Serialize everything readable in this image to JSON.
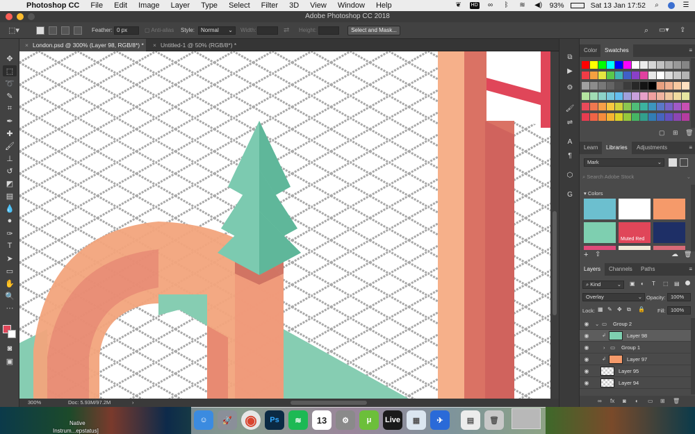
{
  "menubar": {
    "app_name": "Photoshop CC",
    "items": [
      "File",
      "Edit",
      "Image",
      "Layer",
      "Type",
      "Select",
      "Filter",
      "3D",
      "View",
      "Window",
      "Help"
    ],
    "status_icons": [
      "evernote-icon",
      "hd-icon",
      "creative-cloud-icon",
      "bluetooth-icon",
      "wifi-icon",
      "volume-icon"
    ],
    "battery": "93%",
    "datetime": "Sat 13 Jan  17:52"
  },
  "window": {
    "title": "Adobe Photoshop CC 2018"
  },
  "options": {
    "feather_label": "Feather:",
    "feather_value": "0 px",
    "antialias_label": "Anti-alias",
    "style_label": "Style:",
    "style_value": "Normal",
    "width_label": "Width:",
    "height_label": "Height:",
    "select_mask_label": "Select and Mask..."
  },
  "tabs": [
    {
      "label": "London.psd @ 300% (Layer 98, RGB/8*) *"
    },
    {
      "label": "Untitled-1 @ 50% (RGB/8*) *"
    }
  ],
  "status": {
    "zoom": "300%",
    "doc": "Doc: 5.93M/97.2M"
  },
  "color_panel": {
    "tabs": [
      "Color",
      "Swatches"
    ],
    "active_tab": "Swatches",
    "swatch_rows": [
      [
        "#ff0000",
        "#ffff00",
        "#00ff00",
        "#00ffff",
        "#0000ff",
        "#ff00ff",
        "#ffffff",
        "#ebebeb",
        "#d6d6d6",
        "#c2c2c2",
        "#adadad",
        "#999999",
        "#858585"
      ],
      [
        "#f03c46",
        "#f5a040",
        "#e6e640",
        "#5ac84a",
        "#40b4b4",
        "#4060c8",
        "#8a40c8",
        "#e040a0",
        "#e8e8e8",
        "#ffffff",
        "#dcdcdc",
        "#c8c8c8",
        "#b4b4b4"
      ],
      [
        "#a0a0a0",
        "#8c8c8c",
        "#787878",
        "#646464",
        "#505050",
        "#3c3c3c",
        "#282828",
        "#141414",
        "#000000",
        "#e8a080",
        "#f0b090",
        "#f8c8a0",
        "#ffe0c0"
      ],
      [
        "#b4e6a0",
        "#a0dcb4",
        "#8cd2c8",
        "#78c8dc",
        "#64beF0",
        "#a0a0dc",
        "#c8a0dc",
        "#e6a0c8",
        "#f0a0a0",
        "#f0b4a0",
        "#f0c8a0",
        "#f0dca0",
        "#e6e6a0"
      ],
      [
        "#e84a5a",
        "#f07850",
        "#f8a048",
        "#f8c840",
        "#d2d23c",
        "#8cc850",
        "#50be78",
        "#3cb4a0",
        "#3c96be",
        "#5a78c8",
        "#7864c8",
        "#a05ac8",
        "#c850b4"
      ],
      [
        "#e63c50",
        "#f06446",
        "#f58c3c",
        "#f5b432",
        "#dcd228",
        "#96c83c",
        "#46b464",
        "#32a08c",
        "#327db4",
        "#4664be",
        "#6450be",
        "#8c46b4",
        "#b43ca0"
      ]
    ]
  },
  "libraries_panel": {
    "tabs": [
      "Learn",
      "Libraries",
      "Adjustments"
    ],
    "active_tab": "Libraries",
    "library_name": "Mark",
    "search_placeholder": "Search Adobe Stock",
    "section": "Colors",
    "colors": [
      {
        "hex": "#6cbfcf"
      },
      {
        "hex": "#ffffff"
      },
      {
        "hex": "#f59a6a"
      },
      {
        "hex": "#7ecfb0"
      },
      {
        "hex": "#e04659",
        "label": "Muted Red"
      },
      {
        "hex": "#1e2f66"
      },
      {
        "hex": "#e04a7a"
      },
      {
        "hex": "#f2ead8"
      },
      {
        "hex": "#d86a78"
      }
    ]
  },
  "layers_panel": {
    "tabs": [
      "Layers",
      "Channels",
      "Paths"
    ],
    "active_tab": "Layers",
    "filter_kind": "Kind",
    "blend_mode": "Overlay",
    "opacity_label": "Opacity:",
    "opacity": "100%",
    "lock_label": "Lock:",
    "fill_label": "Fill:",
    "fill": "100%",
    "layers": [
      {
        "name": "Group 2",
        "type": "group",
        "indent": 0
      },
      {
        "name": "Layer 98",
        "type": "layer",
        "indent": 1,
        "thumb": "#7ecfb0",
        "selected": true
      },
      {
        "name": "Group 1",
        "type": "group",
        "indent": 1
      },
      {
        "name": "Layer 97",
        "type": "layer",
        "indent": 1,
        "thumb": "#f59a6a"
      },
      {
        "name": "Layer 95",
        "type": "layer",
        "indent": 0,
        "thumb": "checker"
      },
      {
        "name": "Layer 94",
        "type": "layer",
        "indent": 0,
        "thumb": "checker"
      }
    ]
  },
  "desktop": {
    "label_1": "Native",
    "label_2": "Instrum...epstatus]"
  },
  "dock": {
    "items": [
      {
        "name": "finder",
        "bg": "#3b8be0",
        "glyph": "☺"
      },
      {
        "name": "launchpad",
        "bg": "#8a8f99",
        "glyph": "🚀"
      },
      {
        "name": "chrome",
        "bg": "#e6e6e6",
        "glyph": "◉"
      },
      {
        "name": "photoshop",
        "bg": "#0b2a44",
        "glyph": "Ps"
      },
      {
        "name": "spotify",
        "bg": "#1db954",
        "glyph": "≋"
      },
      {
        "name": "calendar",
        "bg": "#ffffff",
        "glyph": "13"
      },
      {
        "name": "system-preferences",
        "bg": "#8a8a8a",
        "glyph": "⚙"
      },
      {
        "name": "utorrent",
        "bg": "#6cbf3a",
        "glyph": "μ"
      },
      {
        "name": "ableton-live",
        "bg": "#1a1a1a",
        "glyph": "Live"
      },
      {
        "name": "preview",
        "bg": "#dbe6f0",
        "glyph": "▦"
      },
      {
        "name": "xcode-app",
        "bg": "#2a6ad8",
        "glyph": "✈"
      },
      {
        "name": "document",
        "bg": "#ececec",
        "glyph": "▤"
      },
      {
        "name": "trash",
        "bg": "#c8c8c8",
        "glyph": "🗑"
      }
    ],
    "calendar_month": "JAN"
  }
}
